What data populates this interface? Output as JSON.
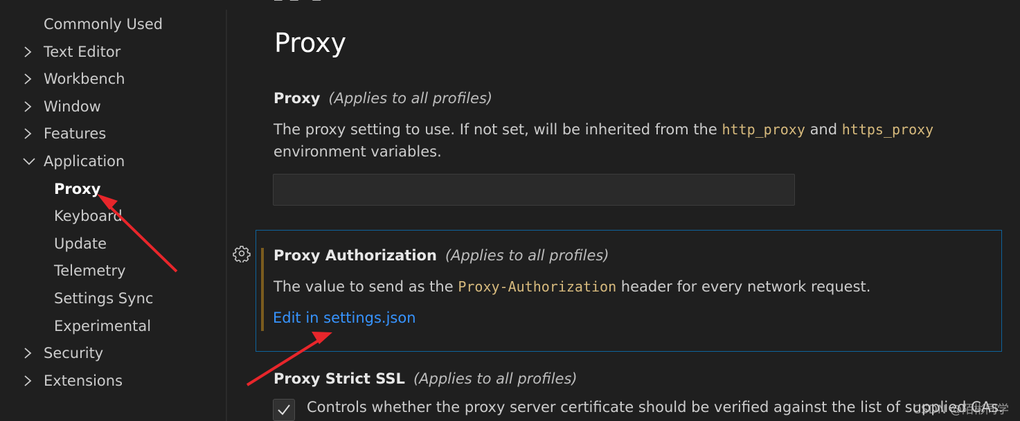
{
  "sidebar": {
    "items": [
      {
        "label": "Commonly Used",
        "level": "top",
        "chevron": "none"
      },
      {
        "label": "Text Editor",
        "level": "top",
        "chevron": "collapsed"
      },
      {
        "label": "Workbench",
        "level": "top",
        "chevron": "collapsed"
      },
      {
        "label": "Window",
        "level": "top",
        "chevron": "collapsed"
      },
      {
        "label": "Features",
        "level": "top",
        "chevron": "collapsed"
      },
      {
        "label": "Application",
        "level": "top",
        "chevron": "expanded"
      },
      {
        "label": "Proxy",
        "level": "sub",
        "active": true
      },
      {
        "label": "Keyboard",
        "level": "sub"
      },
      {
        "label": "Update",
        "level": "sub"
      },
      {
        "label": "Telemetry",
        "level": "sub"
      },
      {
        "label": "Settings Sync",
        "level": "sub"
      },
      {
        "label": "Experimental",
        "level": "sub"
      },
      {
        "label": "Security",
        "level": "top",
        "chevron": "collapsed"
      },
      {
        "label": "Extensions",
        "level": "top",
        "chevron": "collapsed"
      }
    ]
  },
  "main": {
    "section_title": "Proxy",
    "proxy": {
      "name": "Proxy",
      "scope": "(Applies to all profiles)",
      "desc_before": "The proxy setting to use. If not set, will be inherited from the ",
      "code1": "http_proxy",
      "desc_middle": " and ",
      "code2": "https_proxy",
      "desc_after": " environment variables.",
      "value": ""
    },
    "proxy_authorization": {
      "name": "Proxy Authorization",
      "scope": "(Applies to all profiles)",
      "desc_before": "The value to send as the ",
      "code": "Proxy-Authorization",
      "desc_after": " header for every network request.",
      "link": "Edit in settings.json"
    },
    "proxy_strict_ssl": {
      "name": "Proxy Strict SSL",
      "scope": "(Applies to all profiles)",
      "checked": true,
      "label": "Controls whether the proxy server certificate should be verified against the list of supplied CAs."
    }
  },
  "watermark": "CSDN @陌彬同学",
  "colors": {
    "background": "#1f1f1f",
    "link": "#3794ff",
    "focus_border": "#0e639c",
    "code": "#d7ba7d",
    "modified_indicator": "#7a5b1e",
    "annotation_arrow": "#e8262b"
  },
  "icons": {
    "settings_gear": "gear-icon",
    "chevron_right": "chevron-right-icon",
    "chevron_down": "chevron-down-icon",
    "check": "check-icon"
  }
}
